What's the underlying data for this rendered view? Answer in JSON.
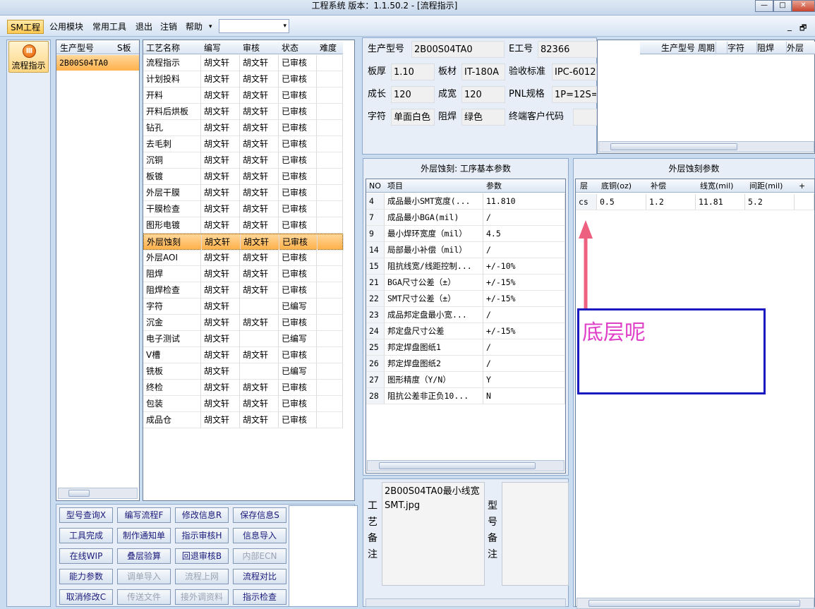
{
  "window": {
    "title": "工程系统  版本：1.1.50.2 - [流程指示]",
    "min": "—",
    "max": "□",
    "close": "✕"
  },
  "menu": {
    "sm": "SM工程",
    "items": [
      "公用模块",
      "常用工具",
      "退出",
      "注销",
      "帮助"
    ],
    "help_arrow": "▾",
    "combo_arrow": "▾",
    "doc_min": "_",
    "doc_restore": "🗗"
  },
  "sidebar": {
    "button_label": "流程指示"
  },
  "product_list": {
    "headers": [
      "生产型号",
      "S板"
    ],
    "rows": [
      "2B00S04TA0"
    ]
  },
  "process_grid": {
    "headers": [
      "工艺名称",
      "编写",
      "审核",
      "状态",
      "难度"
    ],
    "rows": [
      [
        "流程指示",
        "胡文轩",
        "胡文轩",
        "已审核"
      ],
      [
        "计划投料",
        "胡文轩",
        "胡文轩",
        "已审核"
      ],
      [
        "开料",
        "胡文轩",
        "胡文轩",
        "已审核"
      ],
      [
        "开料后烘板",
        "胡文轩",
        "胡文轩",
        "已审核"
      ],
      [
        "钻孔",
        "胡文轩",
        "胡文轩",
        "已审核"
      ],
      [
        "去毛刺",
        "胡文轩",
        "胡文轩",
        "已审核"
      ],
      [
        "沉铜",
        "胡文轩",
        "胡文轩",
        "已审核"
      ],
      [
        "板镀",
        "胡文轩",
        "胡文轩",
        "已审核"
      ],
      [
        "外层干膜",
        "胡文轩",
        "胡文轩",
        "已审核"
      ],
      [
        "干膜检查",
        "胡文轩",
        "胡文轩",
        "已审核"
      ],
      [
        "图形电镀",
        "胡文轩",
        "胡文轩",
        "已审核"
      ],
      [
        "外层蚀刻",
        "胡文轩",
        "胡文轩",
        "已审核"
      ],
      [
        "外层AOI",
        "胡文轩",
        "胡文轩",
        "已审核"
      ],
      [
        "阻焊",
        "胡文轩",
        "胡文轩",
        "已审核"
      ],
      [
        "阻焊检查",
        "胡文轩",
        "胡文轩",
        "已审核"
      ],
      [
        "字符",
        "胡文轩",
        "",
        "已编写"
      ],
      [
        "沉金",
        "胡文轩",
        "胡文轩",
        "已审核"
      ],
      [
        "电子测试",
        "胡文轩",
        "",
        "已编写"
      ],
      [
        "V槽",
        "胡文轩",
        "胡文轩",
        "已审核"
      ],
      [
        "铣板",
        "胡文轩",
        "",
        "已编写"
      ],
      [
        "终检",
        "胡文轩",
        "胡文轩",
        "已审核"
      ],
      [
        "包装",
        "胡文轩",
        "胡文轩",
        "已审核"
      ],
      [
        "成品仓",
        "胡文轩",
        "胡文轩",
        "已审核"
      ]
    ],
    "selected_index": 11
  },
  "buttons": [
    {
      "label": "型号查询X",
      "enabled": true
    },
    {
      "label": "编写流程F",
      "enabled": true
    },
    {
      "label": "修改信息R",
      "enabled": true
    },
    {
      "label": "保存信息S",
      "enabled": true
    },
    {
      "label": "工具完成",
      "enabled": true
    },
    {
      "label": "制作通知单",
      "enabled": true
    },
    {
      "label": "指示审核H",
      "enabled": true
    },
    {
      "label": "信息导入",
      "enabled": true
    },
    {
      "label": "在线WIP",
      "enabled": true
    },
    {
      "label": "叠层验算",
      "enabled": true
    },
    {
      "label": "回退审核B",
      "enabled": true
    },
    {
      "label": "内部ECN",
      "enabled": false
    },
    {
      "label": "能力参数",
      "enabled": true
    },
    {
      "label": "调单导入",
      "enabled": false
    },
    {
      "label": "流程上网",
      "enabled": false
    },
    {
      "label": "流程对比",
      "enabled": true
    },
    {
      "label": "取消修改C",
      "enabled": true
    },
    {
      "label": "传送文件",
      "enabled": false
    },
    {
      "label": "接外调资料",
      "enabled": false
    },
    {
      "label": "指示检查",
      "enabled": true
    }
  ],
  "info": {
    "model_label": "生产型号",
    "model_value": "2B00S04TA0",
    "e_label": "E工号",
    "e_value": "82366",
    "thickness_label": "板厚",
    "thickness_value": "1.10",
    "material_label": "板材",
    "material_value": "IT-180A",
    "standard_label": "验收标准",
    "standard_value": "IPC-6012",
    "length_label": "成长",
    "length_value": "120",
    "width_label": "成宽",
    "width_value": "120",
    "pnl_label": "PNL规格",
    "pnl_value": "1P=12S=",
    "char_label": "字符",
    "char_value": "单面白色",
    "mask_label": "阻焊",
    "mask_value": "绿色",
    "customer_label": "终端客户代码",
    "customer_value": ""
  },
  "history_grid": {
    "headers": [
      "生产型号",
      "周期",
      "字符",
      "阻焊",
      "外层"
    ]
  },
  "params": {
    "title": "外层蚀刻: 工序基本参数",
    "headers": [
      "NO",
      "项目",
      "参数"
    ],
    "rows": [
      [
        "4",
        "成品最小SMT宽度(...",
        "11.810"
      ],
      [
        "7",
        "成品最小BGA(mil)",
        "/"
      ],
      [
        "9",
        "最小焊环宽度（mil）",
        "4.5"
      ],
      [
        "14",
        "局部最小补偿（mil）",
        "/"
      ],
      [
        "15",
        "阻抗线宽/线距控制...",
        "+/-10%"
      ],
      [
        "21",
        "BGA尺寸公差（±）",
        "+/-15%"
      ],
      [
        "22",
        "SMT尺寸公差（±）",
        "+/-15%"
      ],
      [
        "23",
        "成品邦定盘最小宽...",
        "/"
      ],
      [
        "24",
        "邦定盘尺寸公差",
        "+/-15%"
      ],
      [
        "25",
        "邦定焊盘图纸1",
        "/"
      ],
      [
        "26",
        "邦定焊盘图纸2",
        "/"
      ],
      [
        "27",
        "图形精度（Y/N）",
        "Y"
      ],
      [
        "28",
        "阻抗公差非正负10...",
        "N"
      ]
    ]
  },
  "etch": {
    "title": "外层蚀刻参数",
    "headers": [
      "层",
      "底铜(oz)",
      "补偿",
      "线宽(mil)",
      "间距(mil)",
      "+"
    ],
    "rows": [
      [
        "cs",
        "0.5",
        "1.2",
        "11.81",
        "5.2"
      ]
    ]
  },
  "remarks": {
    "process_label": "工艺备注",
    "process_text": "2B00S04TA0最小线宽SMT.jpg",
    "model_label": "型号备注",
    "model_text": ""
  },
  "annotation": {
    "text": "底层呢",
    "color": "#e040c8",
    "box_color": "#1a1ac0",
    "arrow_color": "#ee6080"
  }
}
